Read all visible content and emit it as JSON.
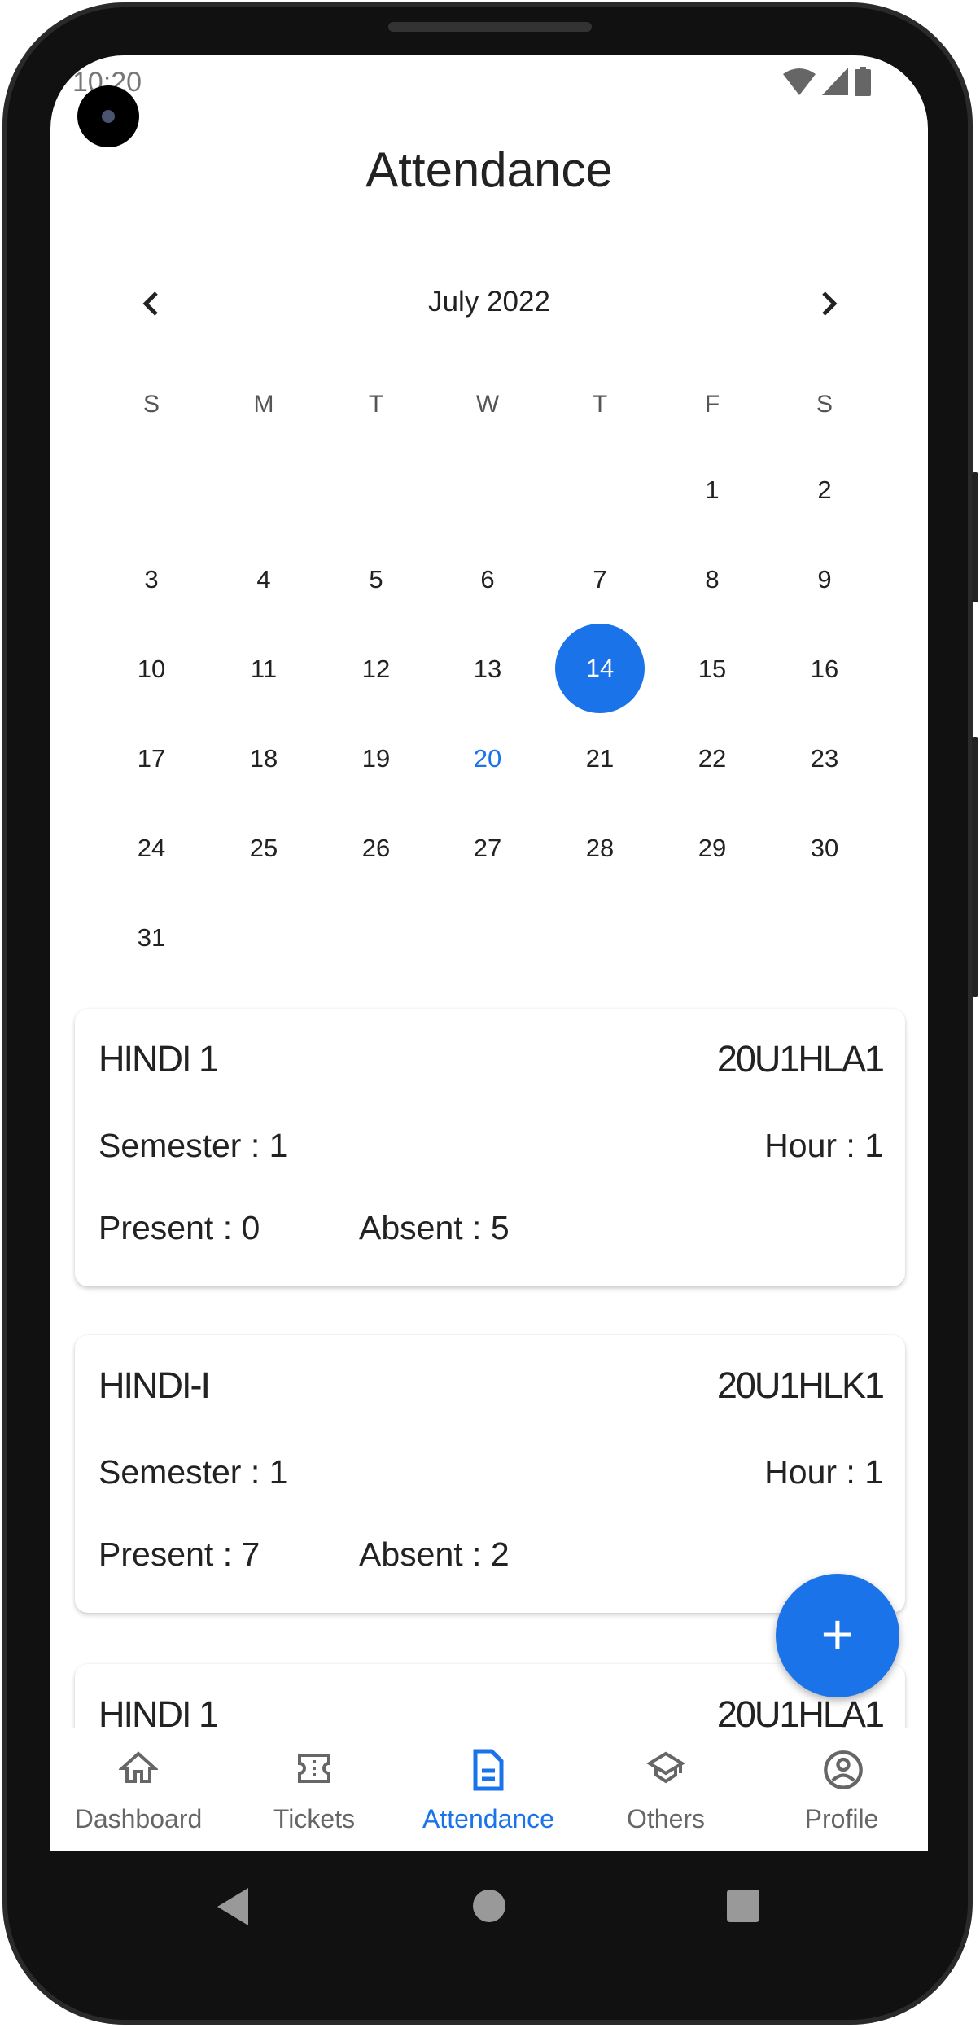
{
  "status_bar": {
    "time": "10:20",
    "icons": [
      "wifi-icon",
      "signal-icon",
      "battery-icon"
    ]
  },
  "header": {
    "title": "Attendance"
  },
  "calendar": {
    "month_label": "July 2022",
    "prev_icon": "chevron-left-icon",
    "next_icon": "chevron-right-icon",
    "weekdays": [
      "S",
      "M",
      "T",
      "W",
      "T",
      "F",
      "S"
    ],
    "first_weekday_index": 5,
    "days_in_month": 31,
    "selected_day": 14,
    "today": 20
  },
  "cards": [
    {
      "name": "HINDI 1",
      "code": "20U1HLA1",
      "semester": "Semester : 1",
      "hour": "Hour : 1",
      "present": "Present : 0",
      "absent": "Absent : 5"
    },
    {
      "name": "HINDI-I",
      "code": "20U1HLK1",
      "semester": "Semester : 1",
      "hour": "Hour : 1",
      "present": "Present : 7",
      "absent": "Absent : 2"
    },
    {
      "name": "HINDI 1",
      "code": "20U1HLA1"
    }
  ],
  "fab": {
    "icon": "plus-icon",
    "label": "+"
  },
  "bottom_nav": [
    {
      "label": "Dashboard",
      "icon": "home-icon"
    },
    {
      "label": "Tickets",
      "icon": "ticket-icon"
    },
    {
      "label": "Attendance",
      "icon": "document-icon",
      "active": true
    },
    {
      "label": "Others",
      "icon": "graduation-cap-icon"
    },
    {
      "label": "Profile",
      "icon": "account-circle-icon"
    }
  ],
  "colors": {
    "accent": "#1a73e8",
    "text": "#222222",
    "nav_inactive": "#666666"
  }
}
